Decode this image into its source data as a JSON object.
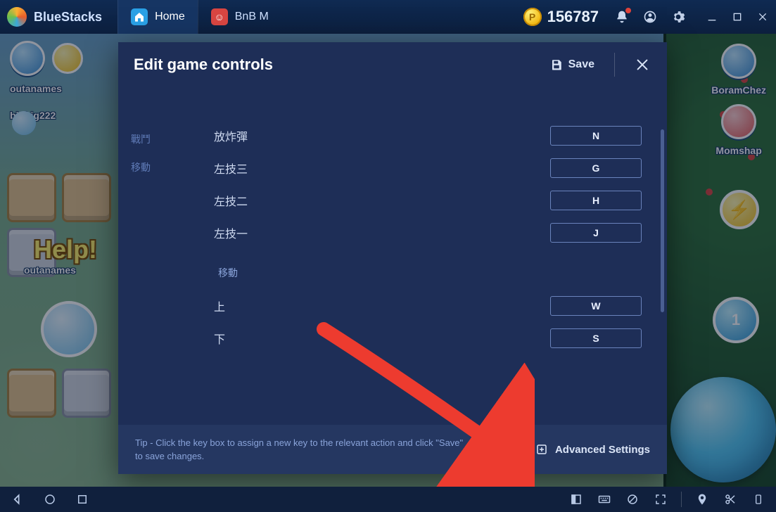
{
  "brand": "BlueStacks",
  "tabs": [
    {
      "label": "Home"
    },
    {
      "label": "BnB M"
    }
  ],
  "coins": "156787",
  "leftPlayers": [
    {
      "name": "outanames"
    },
    {
      "name": "bigbig222"
    },
    {
      "name": "outanames"
    }
  ],
  "rightPlayers": [
    {
      "name": "BoramChez"
    },
    {
      "name": "Momshap"
    }
  ],
  "helpText": "Help!",
  "medalNumber": "1",
  "dialog": {
    "title": "Edit game controls",
    "saveLabel": "Save",
    "sidenav": {
      "combat": "戰鬥",
      "move": "移動"
    },
    "sections": [
      {
        "rows": [
          {
            "label": "放炸彈",
            "key": "N"
          },
          {
            "label": "左技三",
            "key": "G"
          },
          {
            "label": "左技二",
            "key": "H"
          },
          {
            "label": "左技一",
            "key": "J"
          }
        ]
      },
      {
        "title": "移動",
        "rows": [
          {
            "label": "上",
            "key": "W"
          },
          {
            "label": "下",
            "key": "S"
          }
        ]
      }
    ],
    "tip": "Tip - Click the key box to assign a new key to the relevant action and click \"Save\" to save changes.",
    "advanced": "Advanced Settings"
  }
}
